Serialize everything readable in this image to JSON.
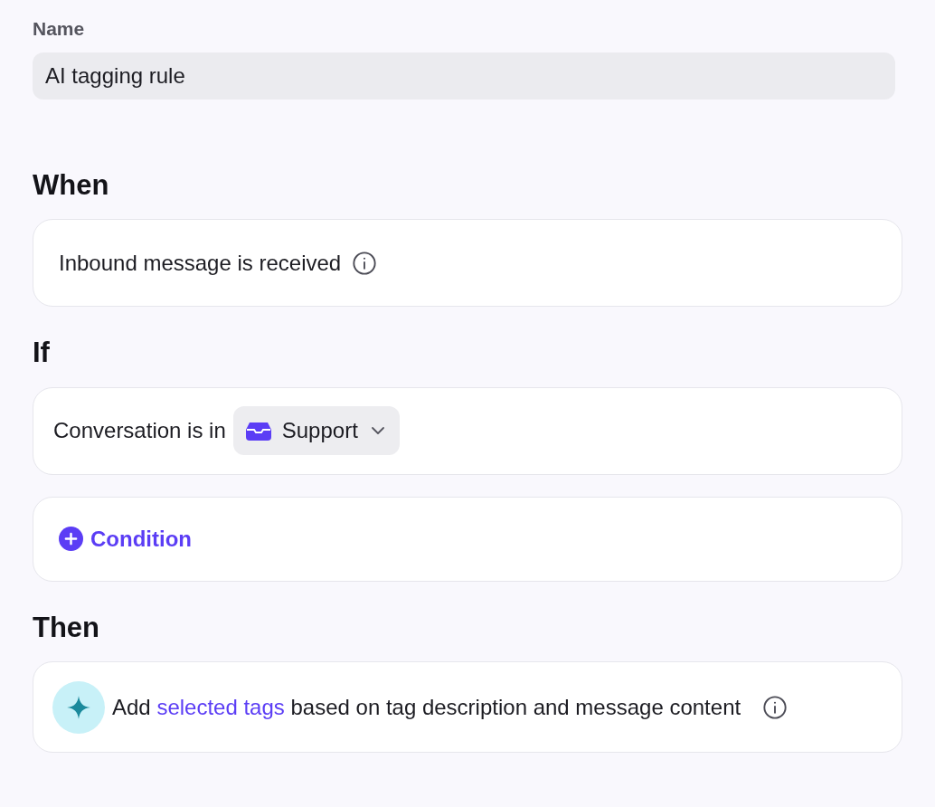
{
  "name_field": {
    "label": "Name",
    "value": "AI tagging rule"
  },
  "sections": [
    {
      "heading": "When",
      "cards": [
        {
          "kind": "trigger",
          "text": "Inbound message is received"
        }
      ]
    },
    {
      "heading": "If",
      "cards": [
        {
          "kind": "condition",
          "prefix": "Conversation is in",
          "dropdown": "Support"
        },
        {
          "kind": "add",
          "label": "Condition"
        }
      ]
    },
    {
      "heading": "Then",
      "cards": [
        {
          "kind": "action",
          "before": "Add",
          "link": "selected tags",
          "after": "based on tag description and message content"
        }
      ]
    }
  ]
}
